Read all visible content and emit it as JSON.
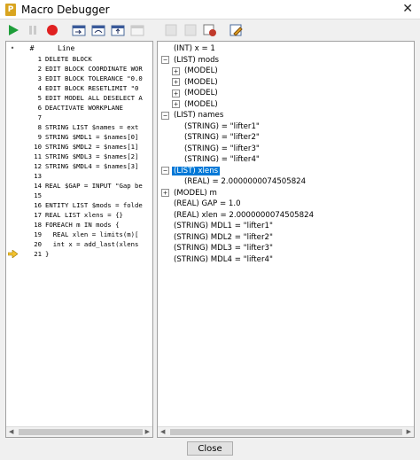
{
  "window": {
    "title": "Macro Debugger",
    "close_glyph": "✕"
  },
  "toolbar": {
    "buttons": [
      {
        "name": "run-icon",
        "enabled": true
      },
      {
        "name": "pause-icon",
        "enabled": false
      },
      {
        "name": "stop-icon",
        "enabled": true
      },
      {
        "name": "step-into-icon",
        "enabled": true
      },
      {
        "name": "step-over-icon",
        "enabled": true
      },
      {
        "name": "step-out-icon",
        "enabled": true
      },
      {
        "name": "run-to-cursor-icon",
        "enabled": false
      },
      {
        "name": "breakpoint-icon",
        "enabled": false
      },
      {
        "name": "clear-breakpoints-icon",
        "enabled": false
      },
      {
        "name": "watch-icon",
        "enabled": true
      },
      {
        "name": "edit-icon",
        "enabled": true
      }
    ]
  },
  "code": {
    "header_mark": "•",
    "header_num": "#",
    "header_line": "Line",
    "current_line": 21,
    "lines": [
      {
        "n": "1",
        "text": "DELETE BLOCK"
      },
      {
        "n": "2",
        "text": "EDIT BLOCK COORDINATE WOR"
      },
      {
        "n": "3",
        "text": "EDIT BLOCK TOLERANCE \"0.0"
      },
      {
        "n": "4",
        "text": "EDIT BLOCK RESETLIMIT \"0"
      },
      {
        "n": "5",
        "text": "EDIT MODEL ALL DESELECT A"
      },
      {
        "n": "6",
        "text": "DEACTIVATE WORKPLANE"
      },
      {
        "n": "7",
        "text": ""
      },
      {
        "n": "8",
        "text": "STRING LIST $names = ext"
      },
      {
        "n": "9",
        "text": "STRING $MDL1 = $names[0]"
      },
      {
        "n": "10",
        "text": "STRING $MDL2 = $names[1]"
      },
      {
        "n": "11",
        "text": "STRING $MDL3 = $names[2]"
      },
      {
        "n": "12",
        "text": "STRING $MDL4 = $names[3]"
      },
      {
        "n": "13",
        "text": ""
      },
      {
        "n": "14",
        "text": "REAL $GAP = INPUT \"Gap be"
      },
      {
        "n": "15",
        "text": ""
      },
      {
        "n": "16",
        "text": "ENTITY LIST $mods = folde"
      },
      {
        "n": "17",
        "text": "REAL LIST xlens = {}"
      },
      {
        "n": "18",
        "text": "FOREACH m IN mods {"
      },
      {
        "n": "19",
        "text": "  REAL xlen = limits(m)["
      },
      {
        "n": "20",
        "text": "  int x = add_last(xlens"
      },
      {
        "n": "21",
        "text": "}"
      }
    ]
  },
  "tree": {
    "rows": [
      {
        "depth": 0,
        "toggle": "",
        "label": "(INT) x = 1",
        "selected": false
      },
      {
        "depth": 0,
        "toggle": "−",
        "label": "(LIST) mods",
        "selected": false
      },
      {
        "depth": 1,
        "toggle": "+",
        "label": "(MODEL)",
        "selected": false
      },
      {
        "depth": 1,
        "toggle": "+",
        "label": "(MODEL)",
        "selected": false
      },
      {
        "depth": 1,
        "toggle": "+",
        "label": "(MODEL)",
        "selected": false
      },
      {
        "depth": 1,
        "toggle": "+",
        "label": "(MODEL)",
        "selected": false
      },
      {
        "depth": 0,
        "toggle": "−",
        "label": "(LIST) names",
        "selected": false
      },
      {
        "depth": 1,
        "toggle": "",
        "label": "(STRING) = \"lifter1\"",
        "selected": false
      },
      {
        "depth": 1,
        "toggle": "",
        "label": "(STRING) = \"lifter2\"",
        "selected": false
      },
      {
        "depth": 1,
        "toggle": "",
        "label": "(STRING) = \"lifter3\"",
        "selected": false
      },
      {
        "depth": 1,
        "toggle": "",
        "label": "(STRING) = \"lifter4\"",
        "selected": false
      },
      {
        "depth": 0,
        "toggle": "−",
        "label": "(LIST) xlens",
        "selected": true
      },
      {
        "depth": 1,
        "toggle": "",
        "label": "(REAL)  = 2.0000000074505824",
        "selected": false
      },
      {
        "depth": 0,
        "toggle": "+",
        "label": "(MODEL) m",
        "selected": false
      },
      {
        "depth": 0,
        "toggle": "",
        "label": "(REAL) GAP = 1.0",
        "selected": false
      },
      {
        "depth": 0,
        "toggle": "",
        "label": "(REAL) xlen = 2.0000000074505824",
        "selected": false
      },
      {
        "depth": 0,
        "toggle": "",
        "label": "(STRING) MDL1 = \"lifter1\"",
        "selected": false
      },
      {
        "depth": 0,
        "toggle": "",
        "label": "(STRING) MDL2 = \"lifter2\"",
        "selected": false
      },
      {
        "depth": 0,
        "toggle": "",
        "label": "(STRING) MDL3 = \"lifter3\"",
        "selected": false
      },
      {
        "depth": 0,
        "toggle": "",
        "label": "(STRING) MDL4 = \"lifter4\"",
        "selected": false
      }
    ]
  },
  "footer": {
    "close_label": "Close"
  }
}
